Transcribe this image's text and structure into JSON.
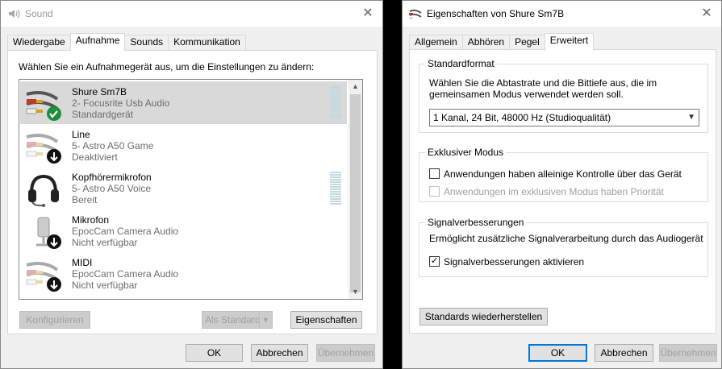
{
  "left_dialog": {
    "title": "Sound",
    "close_glyph": "✕",
    "tabs": [
      {
        "label": "Wiedergabe",
        "active": false
      },
      {
        "label": "Aufnahme",
        "active": true
      },
      {
        "label": "Sounds",
        "active": false
      },
      {
        "label": "Kommunikation",
        "active": false
      }
    ],
    "instruction": "Wählen Sie ein Aufnahmegerät aus, um die Einstellungen zu ändern:",
    "devices": [
      {
        "name": "Shure Sm7B",
        "driver": "2- Focusrite Usb Audio",
        "status": "Standardgerät",
        "icon": "rca-cable-icon",
        "badge": "default-check-badge",
        "selected": true,
        "meter": true
      },
      {
        "name": "Line",
        "driver": "5- Astro A50 Game",
        "status": "Deaktiviert",
        "icon": "rca-cable-icon",
        "badge": "down-arrow-badge",
        "selected": false,
        "meter": false
      },
      {
        "name": "Kopfhörermikrofon",
        "driver": "5- Astro A50 Voice",
        "status": "Bereit",
        "icon": "headset-icon",
        "badge": "none",
        "selected": false,
        "meter": true
      },
      {
        "name": "Mikrofon",
        "driver": "EpocCam Camera Audio",
        "status": "Nicht verfügbar",
        "icon": "microphone-icon",
        "badge": "down-arrow-badge",
        "selected": false,
        "meter": false
      },
      {
        "name": "MIDI",
        "driver": "EpocCam Camera Audio",
        "status": "Nicht verfügbar",
        "icon": "rca-cable-icon",
        "badge": "down-arrow-badge",
        "selected": false,
        "meter": false
      }
    ],
    "buttons": {
      "configure": "Konfigurieren",
      "set_default": "Als Standard",
      "properties": "Eigenschaften",
      "ok": "OK",
      "cancel": "Abbrechen",
      "apply": "Übernehmen"
    }
  },
  "right_dialog": {
    "title": "Eigenschaften von Shure Sm7B",
    "close_glyph": "✕",
    "tabs": [
      {
        "label": "Allgemein",
        "active": false
      },
      {
        "label": "Abhören",
        "active": false
      },
      {
        "label": "Pegel",
        "active": false
      },
      {
        "label": "Erweitert",
        "active": true
      }
    ],
    "default_format": {
      "legend": "Standardformat",
      "description_line1": "Wählen Sie die Abtastrate und die Bittiefe aus, die im",
      "description_line2": "gemeinsamen Modus verwendet werden soll.",
      "selected": "1 Kanal, 24 Bit, 48000 Hz (Studioqualität)"
    },
    "exclusive_mode": {
      "legend": "Exklusiver Modus",
      "allow_exclusive": {
        "label": "Anwendungen haben alleinige Kontrolle über das Gerät",
        "checked": false
      },
      "give_priority": {
        "label": "Anwendungen im exklusiven Modus haben Priorität",
        "checked": false,
        "disabled": true
      }
    },
    "enhancements": {
      "legend": "Signalverbesserungen",
      "description": "Ermöglicht zusätzliche Signalverarbeitung durch das Audiogerät",
      "enable": {
        "label": "Signalverbesserungen aktivieren",
        "checked": true
      }
    },
    "buttons": {
      "restore_defaults": "Standards wiederherstellen",
      "ok": "OK",
      "cancel": "Abbrechen",
      "apply": "Übernehmen"
    }
  },
  "colors": {
    "accent": "#0078d7",
    "check_badge": "#1e8f3c",
    "selected_row": "#d9d9d9",
    "meter": "#c5d7e0"
  }
}
